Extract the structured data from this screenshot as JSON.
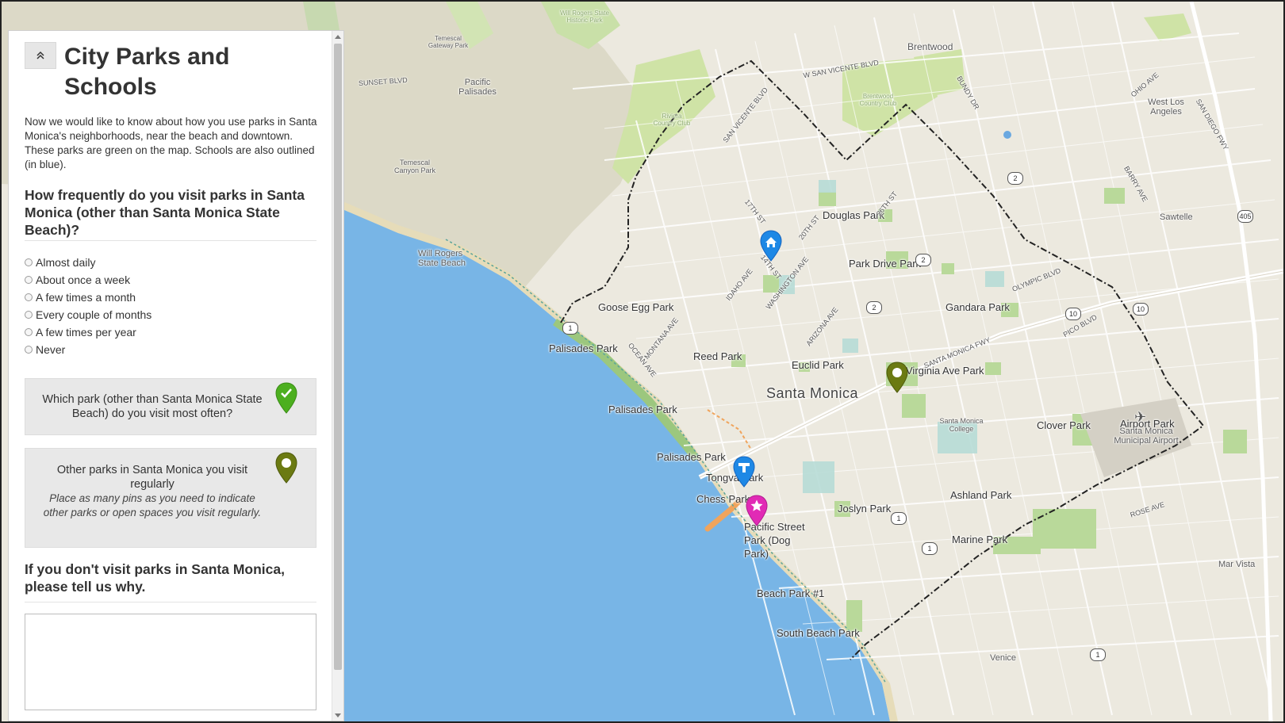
{
  "sidebar": {
    "title": "City Parks and Schools",
    "intro": "Now we would like to know about how you use parks in Santa Monica's neighborhoods, near the beach and downtown. These parks are green on the map. Schools are also outlined (in blue).",
    "question_frequency": {
      "title": "How frequently do you visit parks in Santa Monica (other than Santa Monica State Beach)?",
      "options": [
        "Almost daily",
        "About once a week",
        "A few times a month",
        "Every couple of months",
        "A few times per year",
        "Never"
      ]
    },
    "pin_cards": [
      {
        "title": "Which park (other than Santa Monica State Beach) do you visit most often?",
        "help": "",
        "pin_color": "#4caf1f",
        "icon": "checkmark-icon"
      },
      {
        "title": "Other parks in Santa Monica you visit regularly",
        "help": "Place as many pins as you need to indicate other parks or open spaces you visit regularly.",
        "pin_color": "#6b7a12",
        "icon": "circle-dot-icon"
      }
    ],
    "question_why": {
      "title": "If you don't visit parks in Santa Monica, please tell us why.",
      "value": "",
      "placeholder": ""
    }
  },
  "map": {
    "city": "Santa Monica",
    "parks": [
      "Douglas Park",
      "Park Drive Park",
      "Goose Egg Park",
      "Gandara Park",
      "Palisades Park",
      "Reed Park",
      "Euclid Park",
      "Virginia Ave Park",
      "Palisades Park",
      "Clover Park",
      "Airport Park",
      "Palisades Park",
      "Tongva Park",
      "Chess Park",
      "Pacific Street Park (Dog Park)",
      "Joslyn Park",
      "Ashland Park",
      "Marine Park",
      "Beach Park #1",
      "South Beach Park",
      "Will Rogers State Beach"
    ],
    "areas": [
      "Pacific Palisades",
      "Brentwood",
      "West Los Angeles",
      "Sawtelle",
      "Santa Monica College",
      "Santa Monica Municipal Airport",
      "Mar Vista",
      "Venice",
      "Will Rogers State Historic Park",
      "Temescal Gateway Park",
      "Temescal Canyon Park",
      "Riviera Country Club",
      "Brentwood Country Club"
    ],
    "streets": [
      "SUNSET BLVD",
      "W SAN VICENTE BLVD",
      "SAN VICENTE BLVD",
      "SANTA MONICA FWY",
      "OLYMPIC BLVD",
      "PICO BLVD",
      "OCEAN AVE",
      "MONTANA AVE",
      "IDAHO AVE",
      "WASHINGTON AVE",
      "ARIZONA AVE",
      "SAN DIEGO FWY",
      "ROSE AVE",
      "26TH ST",
      "20TH ST",
      "17TH ST",
      "14TH ST",
      "BUNDY DR",
      "BARRY AVE",
      "OHIO AVE"
    ],
    "highways": [
      "2",
      "405",
      "10",
      "10",
      "1",
      "1",
      "1",
      "2",
      "2",
      "1"
    ],
    "colors": {
      "water": "#78b5e6",
      "park": "#cfe3a6",
      "land": "#ece9df",
      "hills": "#bfd8a4"
    },
    "pins": [
      {
        "type": "home-pin",
        "color": "#1e88e5"
      },
      {
        "type": "most-visited-pin",
        "color": "#6b7a12"
      },
      {
        "type": "transit-pin",
        "color": "#1e88e5"
      },
      {
        "type": "star-pin",
        "color": "#e12ab5"
      }
    ]
  }
}
